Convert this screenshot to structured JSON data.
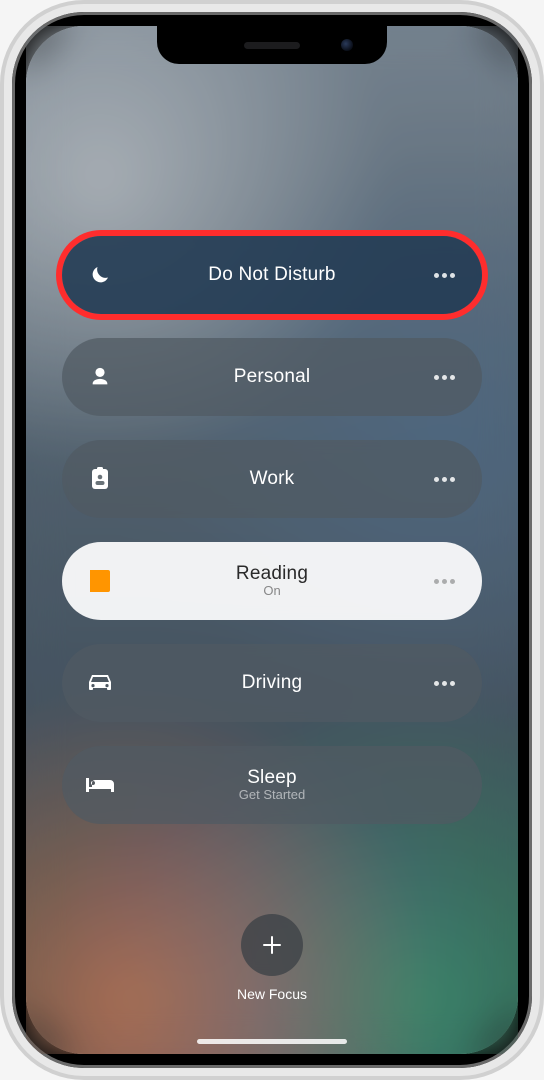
{
  "focus_modes": [
    {
      "label": "Do Not Disturb",
      "sub": "",
      "icon": "moon",
      "state": "highlighted",
      "has_more": true
    },
    {
      "label": "Personal",
      "sub": "",
      "icon": "person",
      "state": "normal",
      "has_more": true
    },
    {
      "label": "Work",
      "sub": "",
      "icon": "badge",
      "state": "normal",
      "has_more": true
    },
    {
      "label": "Reading",
      "sub": "On",
      "icon": "book",
      "state": "active",
      "has_more": true
    },
    {
      "label": "Driving",
      "sub": "",
      "icon": "car",
      "state": "normal",
      "has_more": true
    },
    {
      "label": "Sleep",
      "sub": "Get Started",
      "icon": "bed",
      "state": "normal",
      "has_more": false
    }
  ],
  "new_focus": {
    "label": "New Focus"
  },
  "colors": {
    "highlight_ring": "#ff2d2d",
    "active_icon": "#ff9500"
  }
}
